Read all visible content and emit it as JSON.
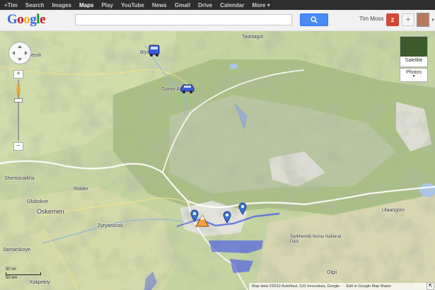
{
  "topbar": {
    "items": [
      {
        "label": "+Tim",
        "active": false
      },
      {
        "label": "Search",
        "active": false
      },
      {
        "label": "Images",
        "active": false
      },
      {
        "label": "Maps",
        "active": true
      },
      {
        "label": "Play",
        "active": false
      },
      {
        "label": "YouTube",
        "active": false
      },
      {
        "label": "News",
        "active": false
      },
      {
        "label": "Gmail",
        "active": false
      },
      {
        "label": "Drive",
        "active": false
      },
      {
        "label": "Calendar",
        "active": false
      },
      {
        "label": "More ▾",
        "active": false
      }
    ]
  },
  "header": {
    "logo": [
      "G",
      "o",
      "o",
      "g",
      "l",
      "e"
    ],
    "logo_colors": [
      "#3369e8",
      "#d50f25",
      "#eeb211",
      "#3369e8",
      "#009925",
      "#d50f25"
    ],
    "search_value": "",
    "user_name": "Tim Moss",
    "notification_count": "2",
    "share_label": "+"
  },
  "map_controls": {
    "satellite_label": "Satellite",
    "photos_label": "Photos",
    "zoom_in": "+",
    "zoom_out": "−",
    "scale_top": "50 mi",
    "scale_bottom": "50 km"
  },
  "places": [
    {
      "name": "Aleysk"
    },
    {
      "name": "Biysk"
    },
    {
      "name": "Gorno-Altaysk"
    },
    {
      "name": "Tashtagol"
    },
    {
      "name": "Shemonaikha"
    },
    {
      "name": "Ridder"
    },
    {
      "name": "Glubokoe"
    },
    {
      "name": "Oskemen"
    },
    {
      "name": "Zyryanovsk"
    },
    {
      "name": "Samarskoye"
    },
    {
      "name": "Kokpekty"
    },
    {
      "name": "Ulaangom"
    },
    {
      "name": "Siylkhemiin Nuruu National Park"
    },
    {
      "name": "Ölgii"
    }
  ],
  "copyright": {
    "text": "Map data ©2012 AutoNavi, GIS Innovatsia, Google -",
    "map_maker": "Edit in Google Map Maker"
  },
  "colors": {
    "search_button": "#4a8af4",
    "notification": "#d14836",
    "route_overlay": "#4a5be8",
    "border_line": "#ffffff"
  }
}
